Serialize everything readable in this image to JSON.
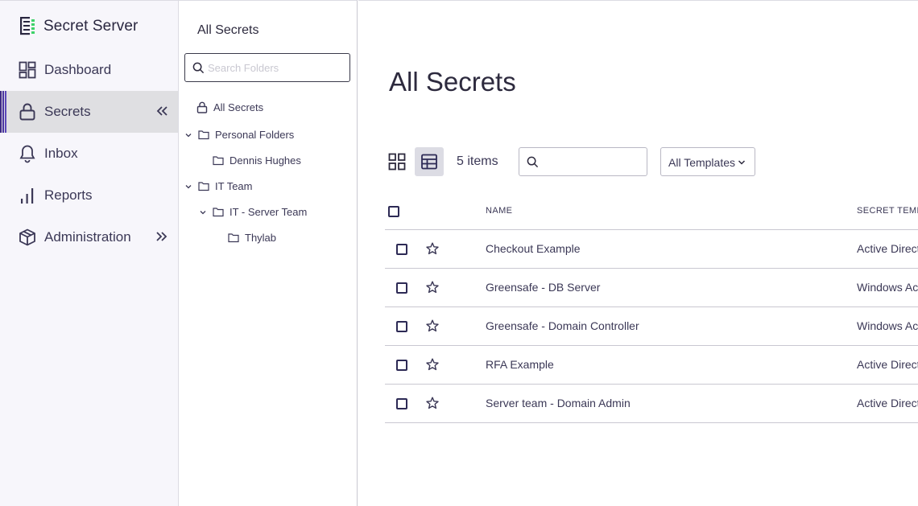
{
  "app": {
    "name": "Secret Server"
  },
  "nav": {
    "items": [
      {
        "label": "Dashboard",
        "icon": "dashboard-icon"
      },
      {
        "label": "Secrets",
        "icon": "lock-icon",
        "active": true,
        "chevron": "«"
      },
      {
        "label": "Inbox",
        "icon": "bell-icon"
      },
      {
        "label": "Reports",
        "icon": "bar-chart-icon"
      },
      {
        "label": "Administration",
        "icon": "cube-icon",
        "chevron": "»"
      }
    ],
    "accent": "#3d2a86"
  },
  "folders": {
    "title": "All Secrets",
    "search_placeholder": "Search Folders",
    "tree": [
      {
        "label": "All Secrets",
        "icon": "lock-icon",
        "level": 0
      },
      {
        "label": "Personal Folders",
        "icon": "folder-icon",
        "level": 0,
        "expanded": true
      },
      {
        "label": "Dennis Hughes",
        "icon": "folder-icon",
        "level": 1
      },
      {
        "label": "IT Team",
        "icon": "folder-icon",
        "level": 0,
        "expanded": true
      },
      {
        "label": "IT - Server Team",
        "icon": "folder-icon",
        "level": 1,
        "expanded": true
      },
      {
        "label": "Thylab",
        "icon": "folder-icon",
        "level": 2
      }
    ]
  },
  "main": {
    "title": "All Secrets",
    "item_count": "5 items",
    "search_value": "",
    "template_filter": "All Templates",
    "columns": {
      "name": "NAME",
      "template": "SECRET TEMPLATE"
    },
    "rows": [
      {
        "name": "Checkout Example",
        "template": "Active Directory Account"
      },
      {
        "name": "Greensafe - DB Server",
        "template": "Windows Account"
      },
      {
        "name": "Greensafe - Domain Controller",
        "template": "Windows Account"
      },
      {
        "name": "RFA Example",
        "template": "Active Directory Account"
      },
      {
        "name": "Server team - Domain Admin",
        "template": "Active Directory Account"
      }
    ]
  }
}
